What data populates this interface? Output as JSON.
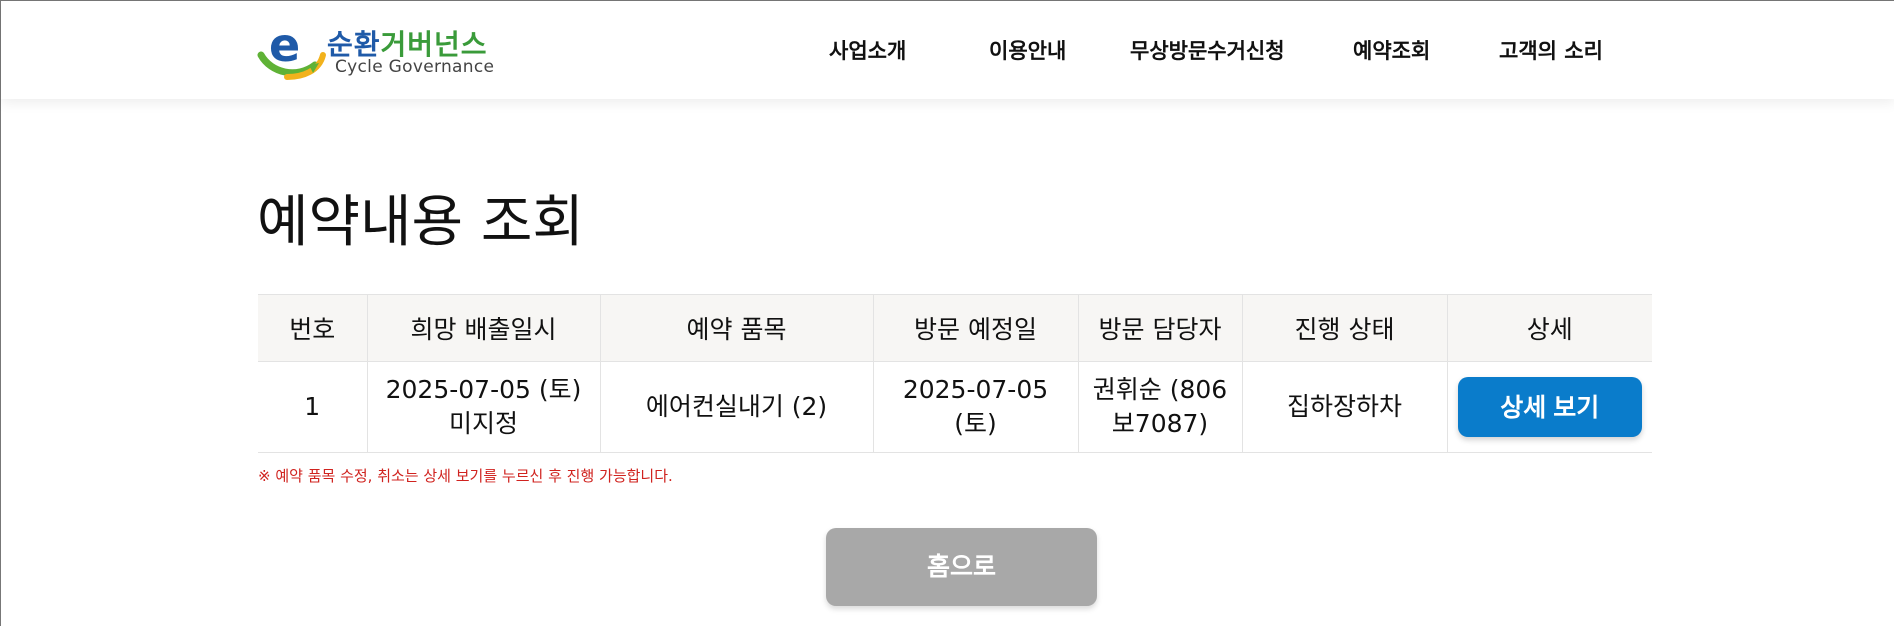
{
  "header": {
    "logo": {
      "name_ko_part1": "순환",
      "name_ko_part2": "거버넌스",
      "name_en": "Cycle Governance"
    },
    "nav": [
      {
        "label": "사업소개"
      },
      {
        "label": "이용안내"
      },
      {
        "label": "무상방문수거신청"
      },
      {
        "label": "예약조회"
      },
      {
        "label": "고객의 소리"
      }
    ]
  },
  "page": {
    "title": "예약내용 조회"
  },
  "table": {
    "headers": [
      "번호",
      "희망 배출일시",
      "예약 품목",
      "방문 예정일",
      "방문 담당자",
      "진행 상태",
      "상세"
    ],
    "rows": [
      {
        "no": "1",
        "desired_date": "2025-07-05 (토)",
        "desired_time": "미지정",
        "items": "에어컨실내기 (2)",
        "visit_date": "2025-07-05 (토)",
        "manager_line1": "권휘순 (806",
        "manager_line2": "보7087)",
        "status": "집하장하차",
        "detail_label": "상세 보기"
      }
    ]
  },
  "notice": "※ 예약 품목 수정, 취소는 상세 보기를 누르신 후 진행 가능합니다.",
  "home_button": "홈으로",
  "colors": {
    "primary_blue": "#0a7ccb",
    "status_blue": "#1f4f9e",
    "notice_red": "#d0231f",
    "home_button_gray": "#a8a8a8",
    "header_bg": "#f7f6f4",
    "logo_blue": "#1f5aa8",
    "logo_green": "#3a9b3a"
  }
}
